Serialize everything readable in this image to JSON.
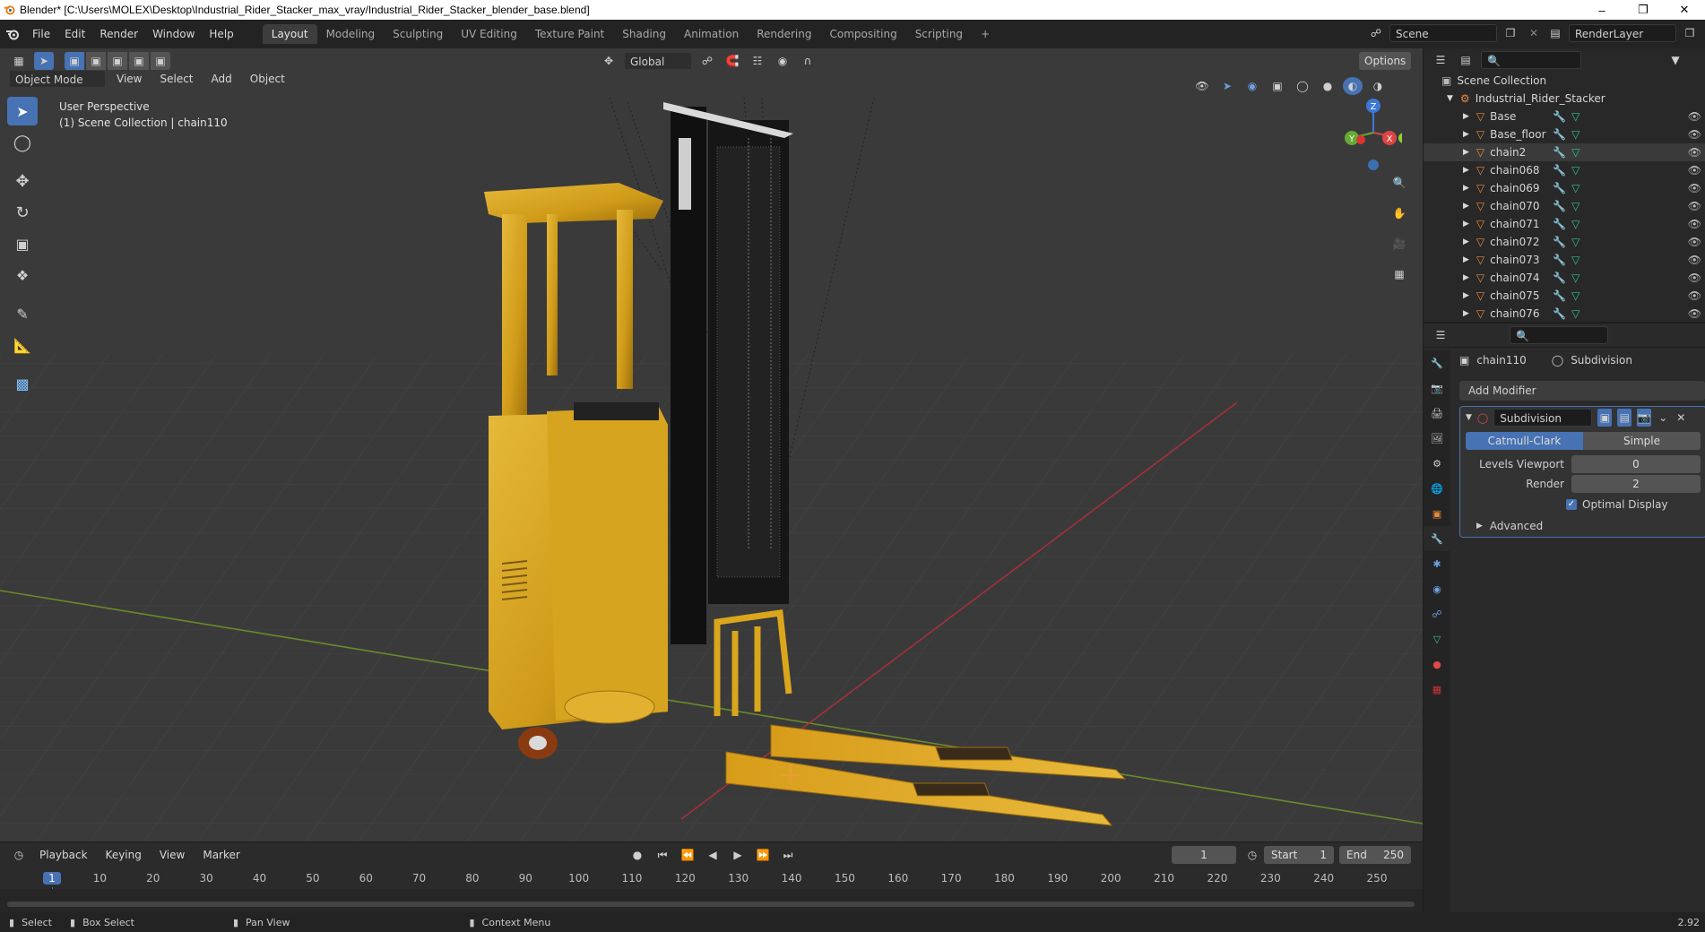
{
  "window": {
    "title": "Blender* [C:\\Users\\MOLEX\\Desktop\\Industrial_Rider_Stacker_max_vray/Industrial_Rider_Stacker_blender_base.blend]",
    "minimize": "–",
    "maximize": "❐",
    "close": "✕"
  },
  "menu": [
    "File",
    "Edit",
    "Render",
    "Window",
    "Help"
  ],
  "workspaces": [
    "Layout",
    "Modeling",
    "Sculpting",
    "UV Editing",
    "Texture Paint",
    "Shading",
    "Animation",
    "Rendering",
    "Compositing",
    "Scripting"
  ],
  "active_workspace": "Layout",
  "add_workspace": "+",
  "scene": {
    "name": "Scene",
    "render_layer": "RenderLayer"
  },
  "viewport": {
    "mode": "Object Mode",
    "menus": [
      "View",
      "Select",
      "Add",
      "Object"
    ],
    "transform_orientation": "Global",
    "options_label": "Options",
    "overlay_line1": "User Perspective",
    "overlay_line2": "(1) Scene Collection | chain110",
    "gizmo": {
      "z": "Z",
      "x": "X",
      "y": "Y"
    }
  },
  "outliner": {
    "root": "Scene Collection",
    "collection": "Industrial_Rider_Stacker",
    "selected": "chain2",
    "items": [
      "Base",
      "Base_floor",
      "chain2",
      "chain068",
      "chain069",
      "chain070",
      "chain071",
      "chain072",
      "chain073",
      "chain074",
      "chain075",
      "chain076"
    ]
  },
  "properties": {
    "object_name": "chain110",
    "modifier_name_crumb": "Subdivision",
    "add_modifier": "Add Modifier",
    "modifier": {
      "name": "Subdivision",
      "type_a": "Catmull-Clark",
      "type_b": "Simple",
      "active_type": "Catmull-Clark",
      "levels_viewport_label": "Levels Viewport",
      "levels_viewport": "0",
      "render_label": "Render",
      "render": "2",
      "optimal_display_label": "Optimal Display",
      "optimal_display": true,
      "advanced_label": "Advanced"
    }
  },
  "timeline": {
    "menus": [
      "Playback",
      "Keying",
      "View",
      "Marker"
    ],
    "current_frame": "1",
    "start_label": "Start",
    "start": "1",
    "end_label": "End",
    "end": "250",
    "ruler": [
      "1",
      "10",
      "20",
      "30",
      "40",
      "50",
      "60",
      "70",
      "80",
      "90",
      "100",
      "110",
      "120",
      "130",
      "140",
      "150",
      "160",
      "170",
      "180",
      "190",
      "200",
      "210",
      "220",
      "230",
      "240",
      "250"
    ]
  },
  "status": {
    "select": "Select",
    "box_select": "Box Select",
    "pan_view": "Pan View",
    "context_menu": "Context Menu",
    "version": "2.92"
  },
  "colors": {
    "accent": "#4772b3",
    "forklift_yellow": "#d9a61c",
    "grid_green": "#6a8a2a",
    "grid_red": "#a0333a",
    "mesh_orange": "#e88a3c",
    "mesh_green": "#35c28a"
  }
}
